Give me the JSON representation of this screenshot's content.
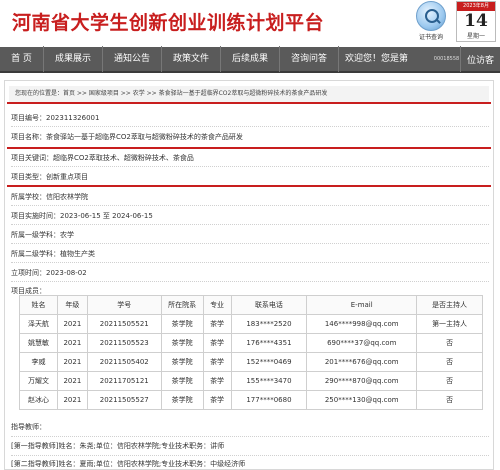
{
  "header": {
    "site_title": "河南省大学生创新创业训练计划平台",
    "cert_label": "证书查询",
    "calendar": {
      "month": "2023年8月",
      "day": "14",
      "weekday": "星期一"
    }
  },
  "nav": {
    "items": [
      "首 页",
      "成果展示",
      "通知公告",
      "政策文件",
      "后续成果",
      "咨询问答"
    ],
    "welcome": "欢迎您！您是第",
    "visitor_count": "00018558",
    "login": "位访客"
  },
  "breadcrumb": "您现在的位置是：首页 >> 国家级项目 >> 农学 >> 茶食驿站一基于超临界CO2萃取与超微粉碎技术的茶食产品研发",
  "project": {
    "number": "项目编号：202311326001",
    "name": "项目名称：茶食驿站一基于超临界CO2萃取与超微粉碎技术的茶食产品研发",
    "keywords": "项目关键词：超临界CO2萃取技术、超微粉碎技术、茶食品",
    "type": "项目类型：创新重点项目",
    "school": "所属学校：信阳农林学院",
    "period": "项目实施时间：2023-06-15 至 2024-06-15",
    "discipline1": "所属一级学科：农学",
    "discipline2": "所属二级学科：植物生产类",
    "approval": "立项时间：2023-08-02",
    "members_title": "项目成员："
  },
  "members": {
    "headers": [
      "姓名",
      "年级",
      "学号",
      "所在院系",
      "专业",
      "联系电话",
      "E-mail",
      "是否主持人"
    ],
    "rows": [
      [
        "泽天航",
        "2021",
        "20211505521",
        "茶学院",
        "茶学",
        "183****2520",
        "146****998@qq.com",
        "第一主持人"
      ],
      [
        "姚慧敏",
        "2021",
        "20211505523",
        "茶学院",
        "茶学",
        "176****4351",
        "690****37@qq.com",
        "否"
      ],
      [
        "李威",
        "2021",
        "20211505402",
        "茶学院",
        "茶学",
        "152****0469",
        "201****676@qq.com",
        "否"
      ],
      [
        "万耀文",
        "2021",
        "20211705121",
        "茶学院",
        "茶学",
        "155****3470",
        "290****870@qq.com",
        "否"
      ],
      [
        "赵冰心",
        "2021",
        "20211505527",
        "茶学院",
        "茶学",
        "177****0680",
        "250****130@qq.com",
        "否"
      ]
    ]
  },
  "teachers": {
    "title": "指导教师：",
    "first": "[第一指导教师]姓名：朱尧;单位：信阳农林学院;专业技术职务：讲师",
    "second": "[第二指导教师]姓名：夏雨;单位：信阳农林学院;专业技术职务：中级经济师"
  }
}
